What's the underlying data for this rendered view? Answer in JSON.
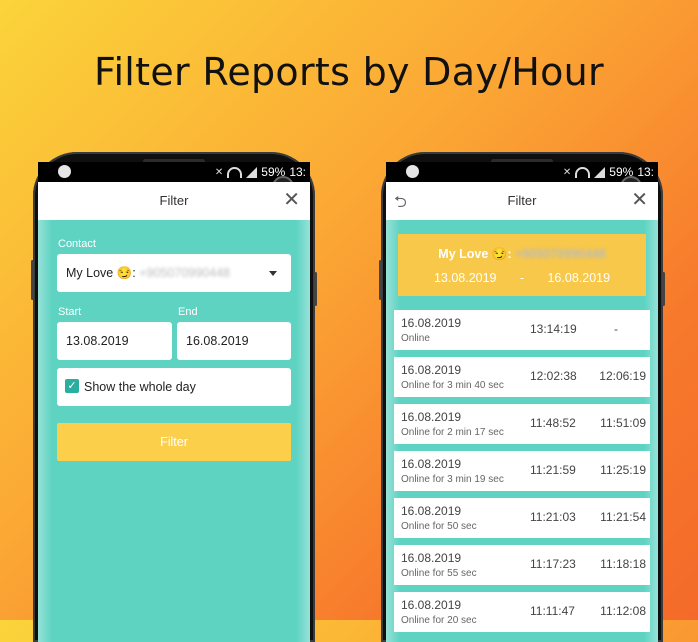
{
  "headline": "Filter Reports by Day/Hour",
  "status_bar": {
    "battery": "59%",
    "time": "13:"
  },
  "left_screen": {
    "title": "Filter",
    "contact_label": "Contact",
    "contact_name": "My Love 😏:",
    "contact_number": "+905070990448",
    "start_label": "Start",
    "end_label": "End",
    "start_date": "13.08.2019",
    "end_date": "16.08.2019",
    "show_whole_day": "Show the whole day",
    "filter_button": "Filter"
  },
  "right_screen": {
    "title": "Filter",
    "summary_name": "My Love 😏:",
    "summary_number": "+905070990448",
    "summary_start": "13.08.2019",
    "summary_sep": "-",
    "summary_end": "16.08.2019",
    "rows": [
      {
        "date": "16.08.2019",
        "status": "Online",
        "start": "13:14:19",
        "end": "-"
      },
      {
        "date": "16.08.2019",
        "status": "Online for 3 min 40 sec",
        "start": "12:02:38",
        "end": "12:06:19"
      },
      {
        "date": "16.08.2019",
        "status": "Online for 2 min 17 sec",
        "start": "11:48:52",
        "end": "11:51:09"
      },
      {
        "date": "16.08.2019",
        "status": "Online for 3 min 19 sec",
        "start": "11:21:59",
        "end": "11:25:19"
      },
      {
        "date": "16.08.2019",
        "status": "Online for 50 sec",
        "start": "11:21:03",
        "end": "11:21:54"
      },
      {
        "date": "16.08.2019",
        "status": "Online for 55 sec",
        "start": "11:17:23",
        "end": "11:18:18"
      },
      {
        "date": "16.08.2019",
        "status": "Online for 20 sec",
        "start": "11:11:47",
        "end": "11:12:08"
      }
    ]
  },
  "colors": {
    "teal": "#5ed3c2",
    "yellow": "#fbcf4a",
    "checkbox": "#2aaea0"
  },
  "icons": [
    "close-icon",
    "back-arrow-icon",
    "wifi-icon",
    "signal-icon",
    "dropdown-caret-icon",
    "check-icon"
  ]
}
